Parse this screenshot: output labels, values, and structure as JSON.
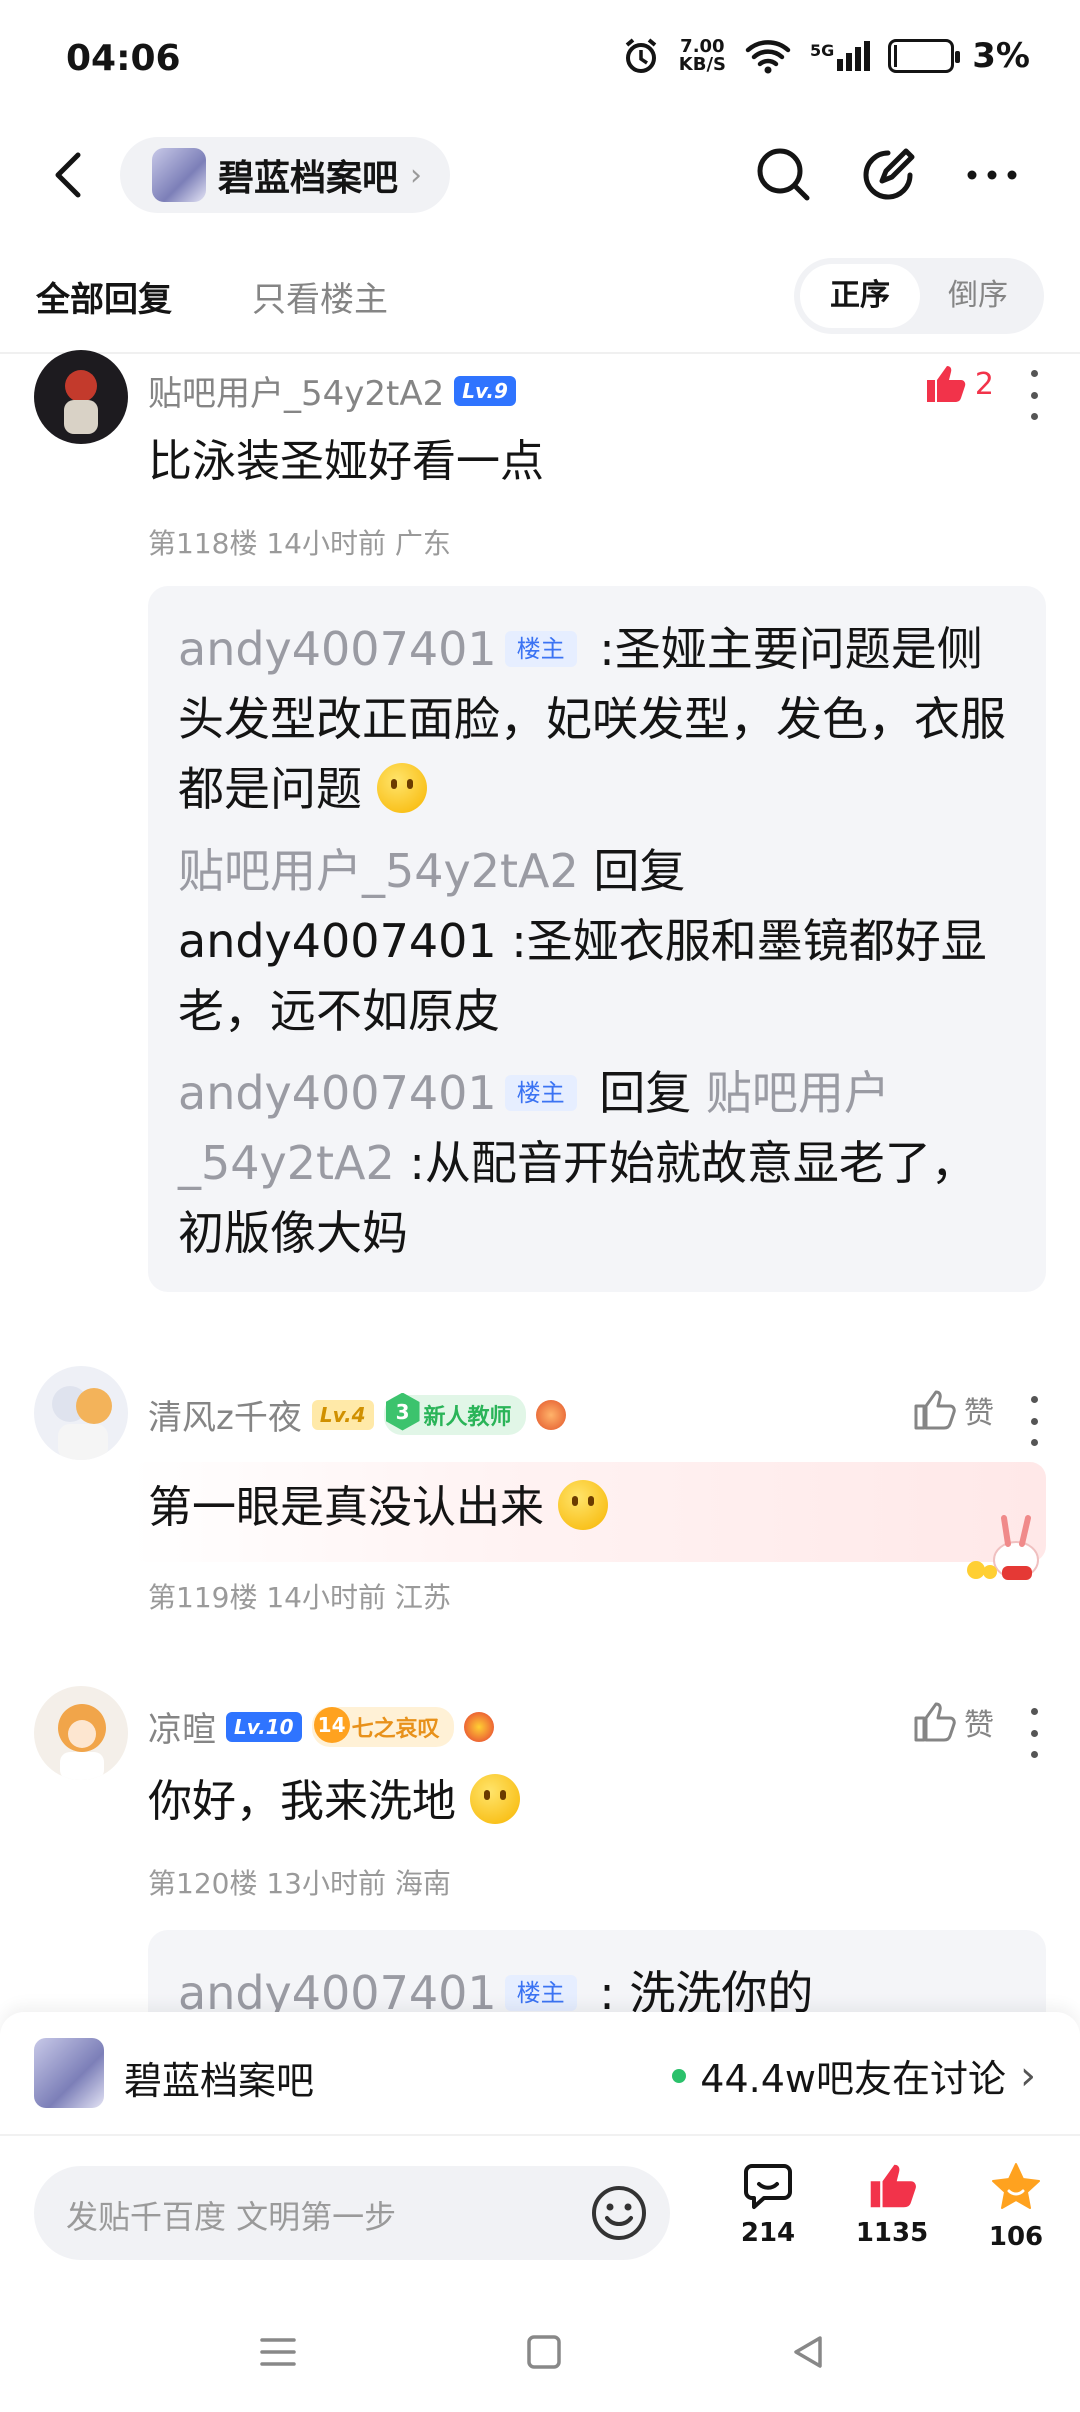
{
  "status_bar": {
    "time": "04:06",
    "net_speed_value": "7.00",
    "net_speed_unit": "KB/S",
    "signal": "5G",
    "battery": "3%"
  },
  "nav": {
    "forum_name": "碧蓝档案吧"
  },
  "tabs": {
    "all_replies": "全部回复",
    "op_only": "只看楼主",
    "order_asc": "正序",
    "order_desc": "倒序"
  },
  "posts": [
    {
      "username": "贴吧用户_54y2tA2",
      "level": "Lv.9",
      "like_count": "2",
      "content": "比泳装圣娅好看一点",
      "meta": "第118楼 14小时前 广东",
      "sub_replies": [
        {
          "author": "andy4007401",
          "host_tag": "楼主",
          "text": " :圣娅主要问题是侧头发型改正面脸，妃咲发型，发色，衣服都是问题 "
        },
        {
          "author": "贴吧用户_54y2tA2",
          "reply_word": " 回复 ",
          "target": "andy4007401",
          "text": " :圣娅衣服和墨镜都好显老，远不如原皮"
        },
        {
          "author": "andy4007401",
          "host_tag": "楼主",
          "reply_word": " 回复 ",
          "target": "贴吧用户_54y2tA2",
          "text": " :从配音开始就故意显老了，初版像大妈"
        }
      ]
    },
    {
      "username": "清风z千夜",
      "level": "Lv.4",
      "badge_num": "3",
      "badge_title": "新人教师",
      "like_label": "赞",
      "content": "第一眼是真没认出来 ",
      "meta": "第119楼 14小时前 江苏"
    },
    {
      "username": "凉暄",
      "level": "Lv.10",
      "badge_num": "14",
      "badge_title": "七之哀叹",
      "like_label": "赞",
      "content": "你好，我来洗地 ",
      "meta": "第120楼 13小时前 海南",
      "sub_replies": [
        {
          "author": "andy4007401",
          "host_tag": "楼主",
          "text": " : 洗洗你的"
        }
      ]
    }
  ],
  "forum_bar": {
    "name": "碧蓝档案吧",
    "online": "44.4w吧友在讨论"
  },
  "input_bar": {
    "placeholder": "发贴千百度 文明第一步",
    "comments": "214",
    "likes": "1135",
    "favorites": "106"
  },
  "colors": {
    "accent_red": "#f2334a",
    "level_blue": "#2f74ff",
    "host_tag_blue": "#3b73f3",
    "online_green": "#2bc16b"
  }
}
